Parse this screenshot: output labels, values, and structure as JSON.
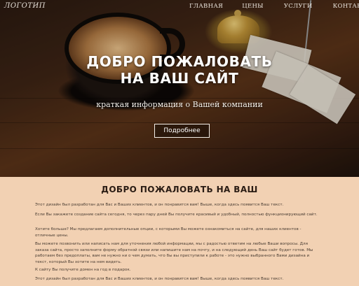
{
  "nav": {
    "logo": "ЛОГОТИП",
    "items": [
      {
        "label": "ГЛАВНАЯ"
      },
      {
        "label": "ЦЕНЫ"
      },
      {
        "label": "УСЛУГИ"
      },
      {
        "label": "КОНТАКТЫ"
      }
    ]
  },
  "hero": {
    "title_line1": "ДОБРО ПОЖАЛОВАТЬ",
    "title_line2": "НА ВАШ САЙТ",
    "subtitle": "краткая информация о Вашей компании",
    "button": "Подробнее"
  },
  "content": {
    "title": "ДОБРО ПОЖАЛОВАТЬ НА ВАШ",
    "paragraphs": [
      "Этот дизайн был разработан для Вас и Ваших клиентов, и он понравится вам! Выше, когда здесь появится Ваш текст.",
      "Если Вы закажете создание сайта сегодня, то через пару дней Вы получите красивый и удобный, полностью функционирующий сайт.",
      "Хотите больше? Мы предлагаем дополнительные опции, с которыми Вы можете ознакомиться на сайте, для наших клиентов - отличные цены.",
      "Вы можете позвонить или написать нам для уточнения любой информации, мы с радостью ответим на любые Ваши вопросы. Для заказа сайта, просто заполните форму обратной связи или напишите нам на почту, и на следующий день Ваш сайт будет готов. Мы работаем без предоплаты, вам не нужно ни о чем думать, что бы вы приступили к работе - это нужно выбранного Вами дизайна и текст, который Вы хотите на нем видеть.",
      "К сайту Вы получите домен на год в подарок.",
      "Этот дизайн был разработан для Вас и Ваших клиентов, и он понравится вам! Выше, когда здесь появится Ваш текст."
    ]
  }
}
